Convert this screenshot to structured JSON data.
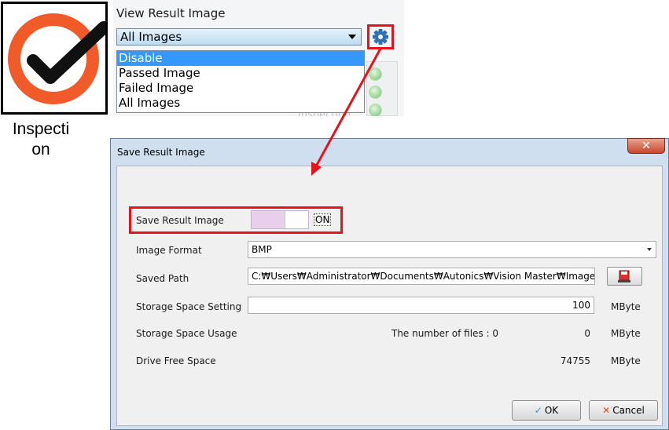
{
  "logo": {
    "icon": "checkmark-circle-icon",
    "label": "Inspecti on",
    "colors": {
      "ring": "#f15a29",
      "check": "#111111"
    }
  },
  "view_result_image": {
    "label": "View Result Image",
    "selected": "All Images",
    "options": [
      "Disable",
      "Passed Image",
      "Failed Image",
      "All Images"
    ],
    "highlighted_option": "Disable",
    "gear_icon": "gear-icon",
    "faded_row_text": "Inspection Comparer"
  },
  "dialog": {
    "title": "Save Result Image",
    "close_icon": "close-icon",
    "save_result_image": {
      "label": "Save Result Image",
      "state": "ON"
    },
    "image_format": {
      "label": "Image Format",
      "value": "BMP"
    },
    "saved_path": {
      "label": "Saved Path",
      "value": "C:₩Users₩Administrator₩Documents₩Autonics₩Vision Master₩Image₩",
      "browse_icon": "folder-save-icon"
    },
    "storage_space_setting": {
      "label": "Storage Space Setting",
      "value": "100",
      "unit": "MByte"
    },
    "storage_space_usage": {
      "label": "Storage Space Usage",
      "files_text": "The number of files : 0",
      "value": "0",
      "unit": "MByte"
    },
    "drive_free_space": {
      "label": "Drive Free Space",
      "value": "74755",
      "unit": "MByte"
    },
    "ok_label": "OK",
    "cancel_label": "Cancel"
  },
  "colors": {
    "highlight": "#e3141b",
    "selection": "#3399ff",
    "toggle_on": "#e8d0ec"
  }
}
